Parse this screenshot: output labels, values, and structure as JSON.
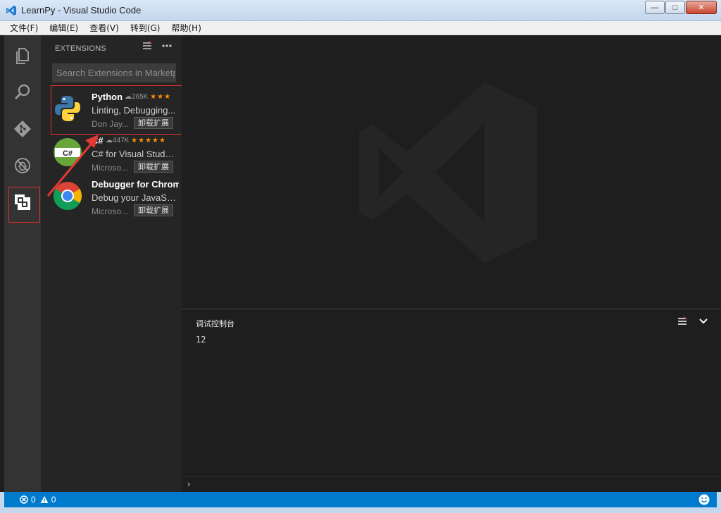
{
  "window": {
    "title": "LearnPy - Visual Studio Code",
    "minimize": "—",
    "maximize": "□",
    "close": "✕"
  },
  "menu": [
    "文件(F)",
    "编辑(E)",
    "查看(V)",
    "转到(G)",
    "帮助(H)"
  ],
  "activitybar": {
    "items": [
      "explorer-icon",
      "search-icon",
      "git-icon",
      "debug-icon",
      "extensions-icon"
    ],
    "active": "extensions-icon"
  },
  "sidebar": {
    "header": "EXTENSIONS",
    "search_placeholder": "Search Extensions in Marketplace",
    "extensions": [
      {
        "name": "Python",
        "downloads": "265K",
        "stars": "★★★",
        "description": "Linting, Debugging...",
        "publisher": "Don Jay...",
        "button": "卸载扩展"
      },
      {
        "name": "C#",
        "downloads": "447K",
        "stars": "★★★★★",
        "description": "C# for Visual Studio...",
        "publisher": "Microso...",
        "button": "卸载扩展"
      },
      {
        "name": "Debugger for Chrome",
        "downloads": "",
        "stars": "",
        "description": "Debug your JavaSc...",
        "publisher": "Microso...",
        "button": "卸载扩展"
      }
    ]
  },
  "panel": {
    "title": "调试控制台",
    "output": "12",
    "prompt": "›"
  },
  "statusbar": {
    "errors": "0",
    "warnings": "0"
  },
  "colors": {
    "accent": "#007acc",
    "highlight": "#e03030",
    "star": "#ff8e00"
  }
}
